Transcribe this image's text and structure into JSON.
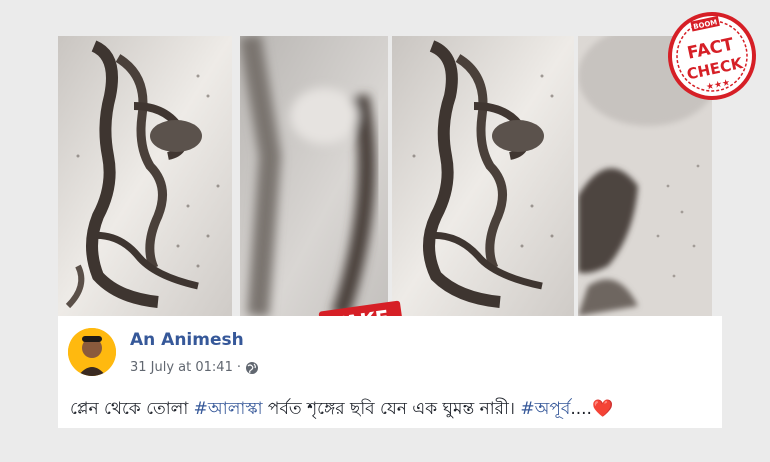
{
  "badge": {
    "brand": "BOOM",
    "line1": "FACT",
    "line2": "CHECK"
  },
  "fake_label": "FAKE",
  "post": {
    "author": "An Animesh",
    "timestamp": "31 July at 01:41",
    "separator": "·",
    "privacy_icon": "globe-icon",
    "text_part1": "প্লেন থেকে তোলা ",
    "hashtag1": "#আলাস্কা",
    "text_part2": " পর্বত শৃঙ্গের ছবি যেন এক ঘুমন্ত নারী। ",
    "hashtag2": "#অপূর্ব",
    "text_part3": "....",
    "emoji": "❤️",
    "emoji_icon": "heart-icon"
  },
  "colors": {
    "stamp_red": "#d61f26",
    "link_blue": "#365899",
    "snow": "#e9e6e2",
    "rock": "#3e3530"
  }
}
